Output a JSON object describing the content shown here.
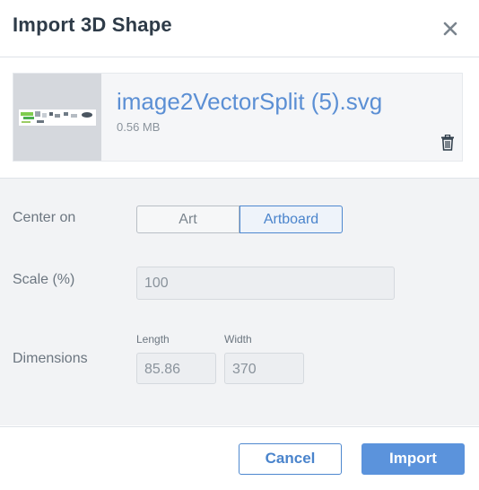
{
  "dialog": {
    "title": "Import 3D Shape",
    "close_icon": "close-icon"
  },
  "file": {
    "name": "image2VectorSplit (5).svg",
    "size": "0.56 MB",
    "thumbnail_icon": "image-thumbnail",
    "delete_icon": "trash-icon"
  },
  "form": {
    "center_on": {
      "label": "Center on",
      "options": [
        "Art",
        "Artboard"
      ],
      "selected": "Artboard"
    },
    "scale": {
      "label": "Scale (%)",
      "value": "100"
    },
    "dimensions": {
      "label": "Dimensions",
      "length_label": "Length",
      "length_value": "85.86",
      "width_label": "Width",
      "width_value": "370"
    }
  },
  "footer": {
    "cancel_label": "Cancel",
    "import_label": "Import"
  },
  "colors": {
    "accent": "#5b93dc",
    "title": "#2e3b48",
    "form_bg": "#f2f3f5"
  }
}
